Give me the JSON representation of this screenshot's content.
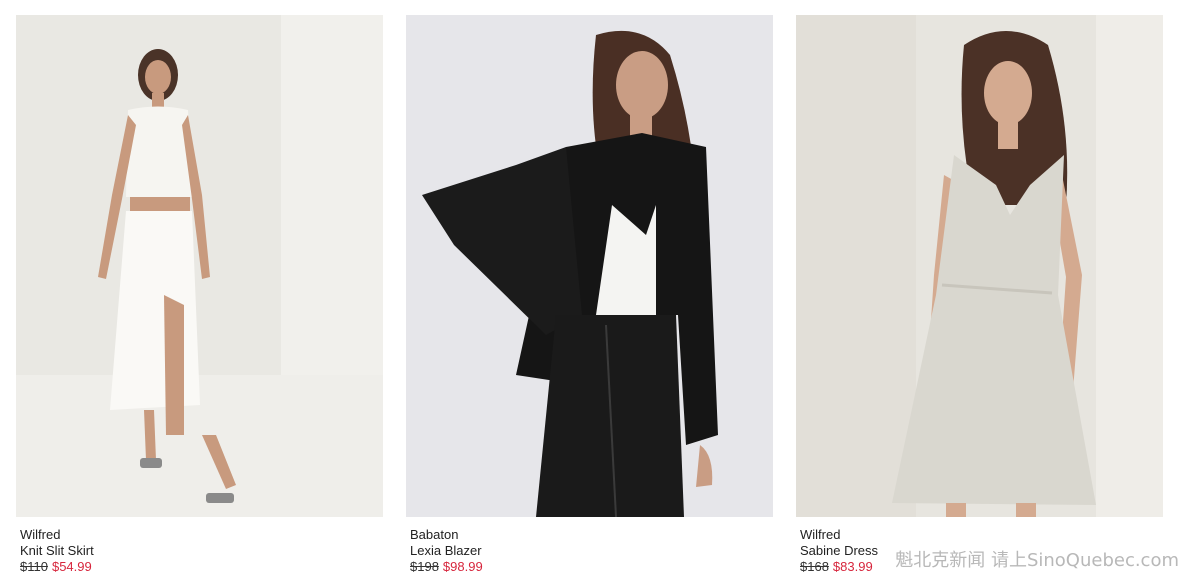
{
  "products": [
    {
      "brand": "Wilfred",
      "name": "Knit Slit Skirt",
      "original_price": "$110",
      "sale_price": "$54.99"
    },
    {
      "brand": "Babaton",
      "name": "Lexia Blazer",
      "original_price": "$198",
      "sale_price": "$98.99"
    },
    {
      "brand": "Wilfred",
      "name": "Sabine Dress",
      "original_price": "$168",
      "sale_price": "$83.99"
    }
  ],
  "watermark": "魁北克新闻 请上SinoQuebec.com",
  "colors": {
    "sale": "#d7263d",
    "text": "#222222"
  }
}
